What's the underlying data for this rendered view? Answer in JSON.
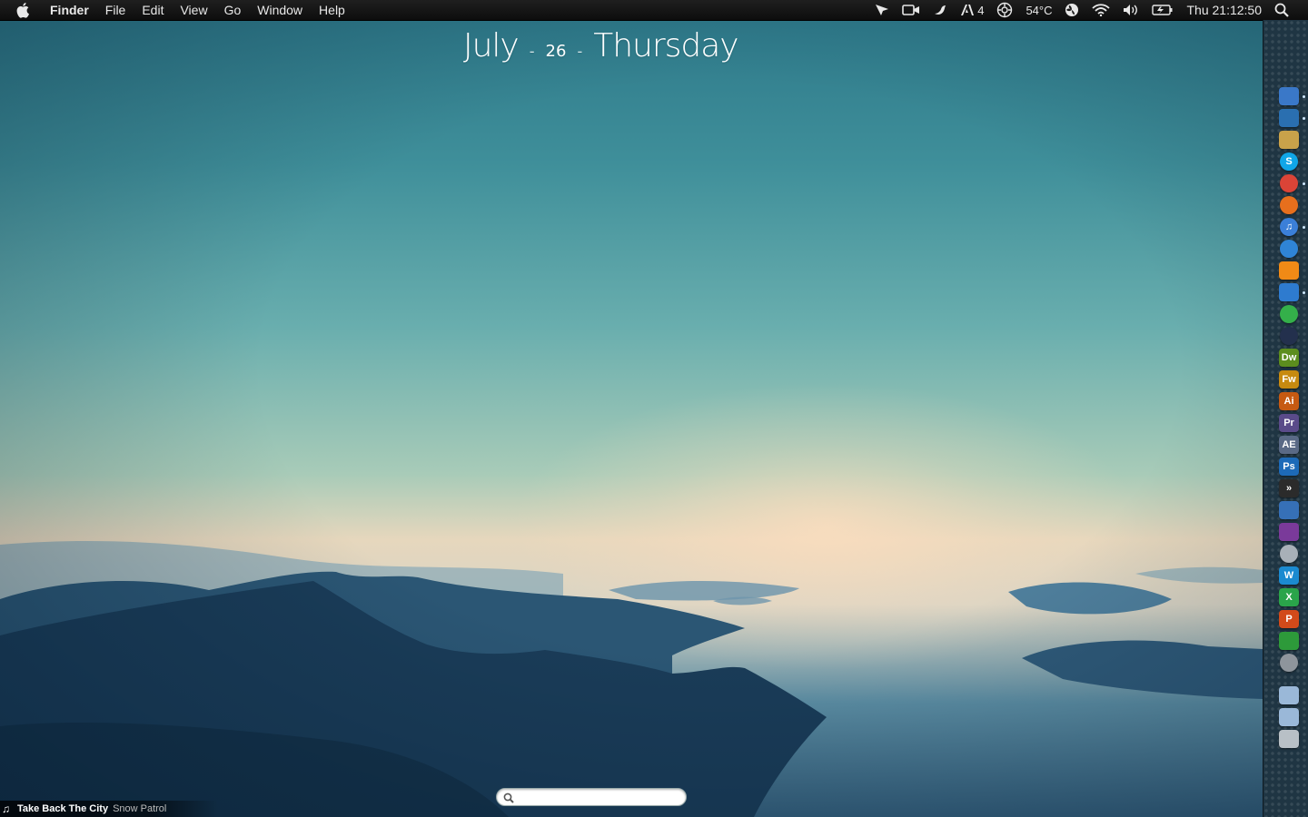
{
  "menubar": {
    "app_name": "Finder",
    "menus": [
      "File",
      "Edit",
      "View",
      "Go",
      "Window",
      "Help"
    ],
    "status": {
      "notification_count": "4",
      "temperature": "54°C",
      "clock": "Thu 21:12:50"
    }
  },
  "date_widget": {
    "month": "July",
    "separator": "-",
    "day": "26",
    "weekday": "Thursday"
  },
  "dock": {
    "icons": [
      {
        "name": "finder",
        "label": "",
        "color": "#3a78c8"
      },
      {
        "name": "send",
        "label": "",
        "color": "#2a6fb0"
      },
      {
        "name": "notes",
        "label": "",
        "color": "#c9a24a"
      },
      {
        "name": "skype",
        "label": "S",
        "color": "#10a6e8"
      },
      {
        "name": "chrome",
        "label": "",
        "color": "#db4437"
      },
      {
        "name": "firefox",
        "label": "",
        "color": "#e76f1d"
      },
      {
        "name": "itunes",
        "label": "♫",
        "color": "#3b7fd8"
      },
      {
        "name": "transmit",
        "label": "",
        "color": "#2f84d6"
      },
      {
        "name": "vlc",
        "label": "",
        "color": "#f08a16"
      },
      {
        "name": "birdie",
        "label": "",
        "color": "#2e7bcf"
      },
      {
        "name": "evernote",
        "label": "",
        "color": "#34b04a"
      },
      {
        "name": "cinema4d",
        "label": "",
        "color": "#23304d"
      },
      {
        "name": "dreamweaver",
        "label": "Dw",
        "color": "#5c8d1e"
      },
      {
        "name": "fireworks",
        "label": "Fw",
        "color": "#c78a10"
      },
      {
        "name": "illustrator",
        "label": "Ai",
        "color": "#c65a12"
      },
      {
        "name": "premiere",
        "label": "Pr",
        "color": "#5a4b8a"
      },
      {
        "name": "aftereffects",
        "label": "AE",
        "color": "#5a6a86"
      },
      {
        "name": "photoshop",
        "label": "Ps",
        "color": "#1d6ab8"
      },
      {
        "name": "final-cut",
        "label": "»",
        "color": "#2b2b2b"
      },
      {
        "name": "imovie",
        "label": "",
        "color": "#3670b7"
      },
      {
        "name": "motion",
        "label": "",
        "color": "#7a3a9a"
      },
      {
        "name": "color",
        "label": "",
        "color": "#a8b0b8"
      },
      {
        "name": "word",
        "label": "W",
        "color": "#1b8ad0"
      },
      {
        "name": "excel",
        "label": "X",
        "color": "#2aa44a"
      },
      {
        "name": "powerpoint",
        "label": "P",
        "color": "#d24a1a"
      },
      {
        "name": "keynote-like",
        "label": "",
        "color": "#2d9a3a"
      },
      {
        "name": "system-prefs",
        "label": "",
        "color": "#8e959c"
      },
      {
        "name": "applications-folder",
        "label": "",
        "color": "#9ab8d8"
      },
      {
        "name": "downloads-folder",
        "label": "",
        "color": "#9ab8d8"
      },
      {
        "name": "trash",
        "label": "",
        "color": "#b8c0c6"
      }
    ]
  },
  "search": {
    "value": ""
  },
  "now_playing": {
    "song": "Take Back The City",
    "artist": "Snow Patrol"
  }
}
